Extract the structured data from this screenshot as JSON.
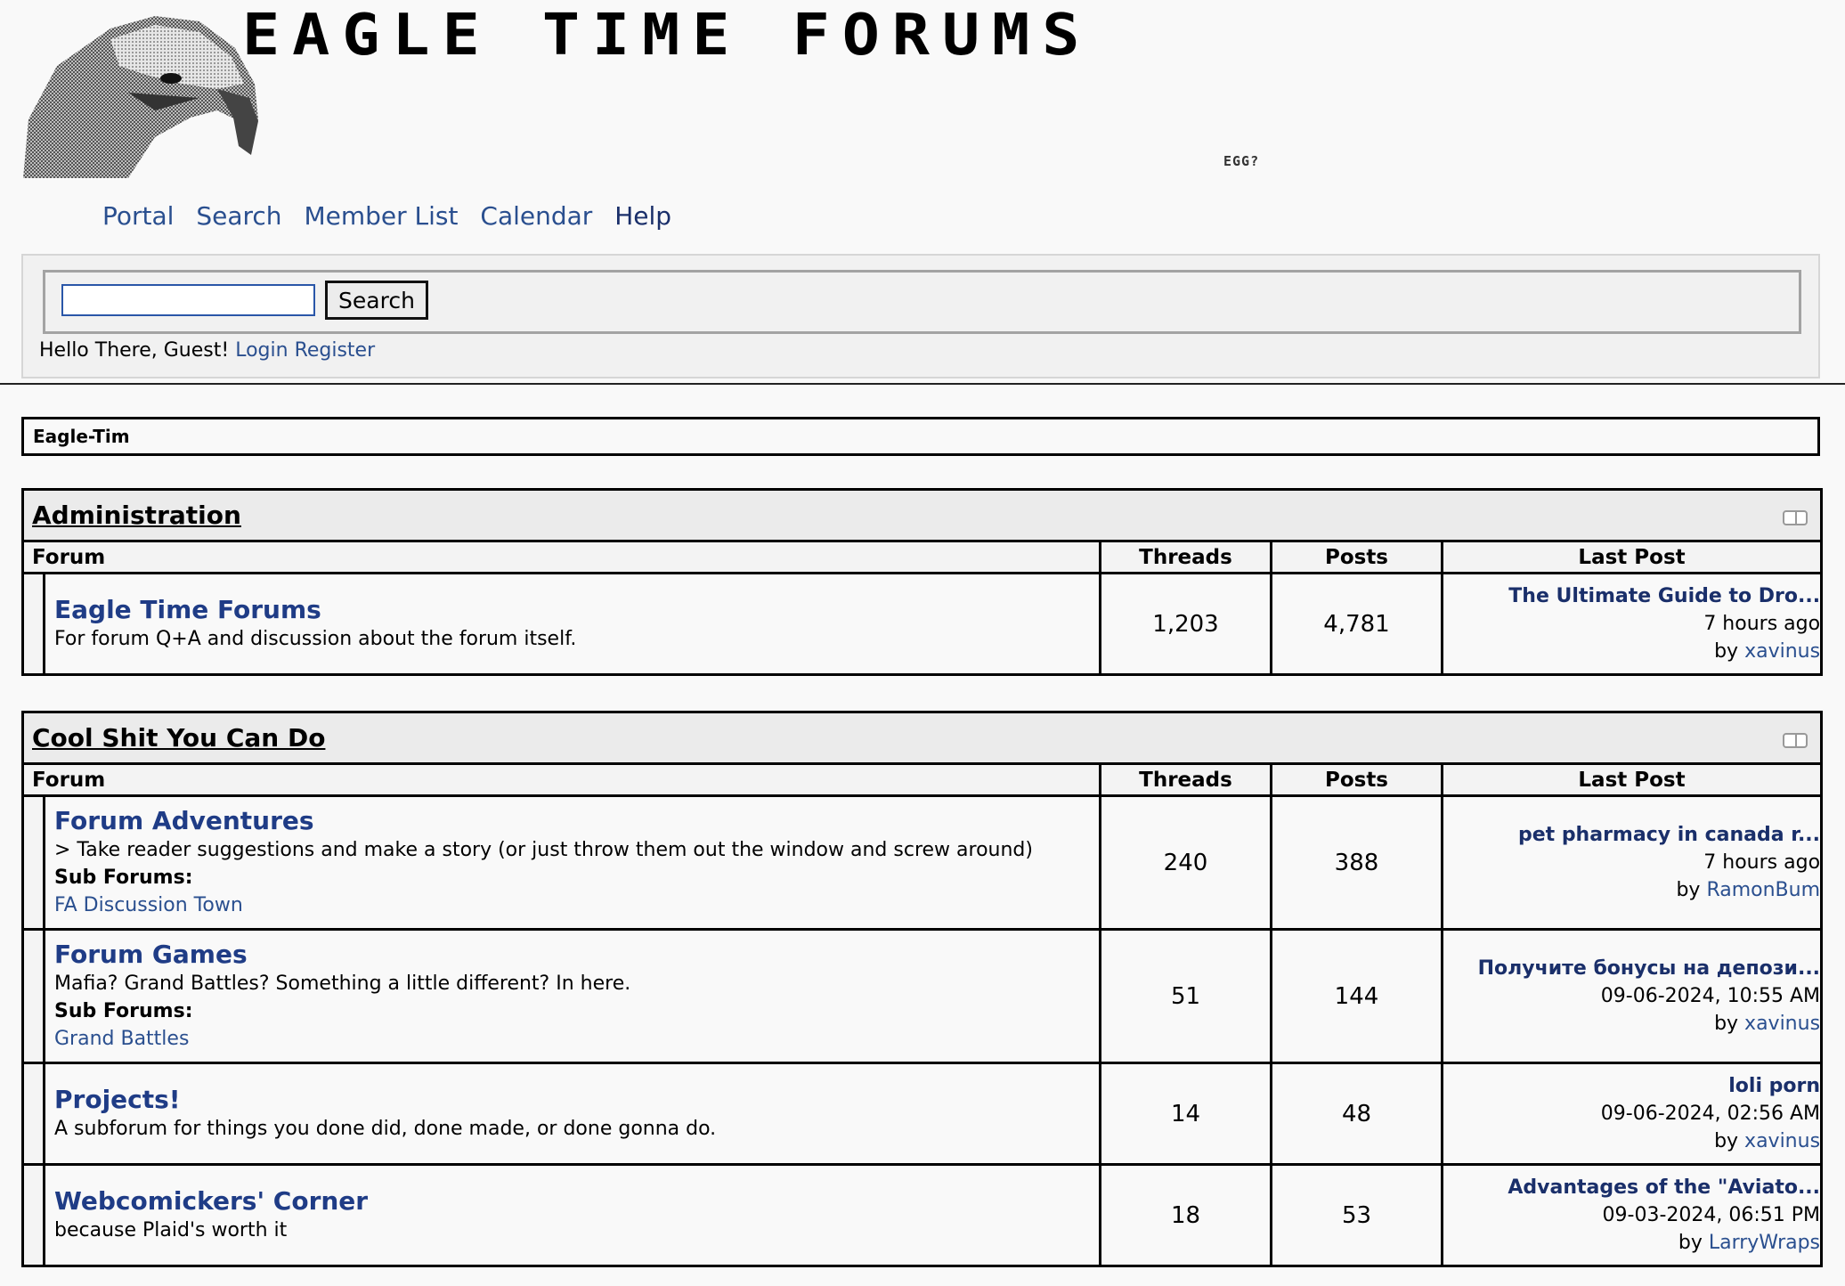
{
  "header": {
    "site_title": "EAGLE TIME FORUMS",
    "egg_text": "EGG?",
    "nav": [
      "Portal",
      "Search",
      "Member List",
      "Calendar",
      "Help"
    ]
  },
  "search": {
    "placeholder": "",
    "button_label": "Search"
  },
  "greeting": {
    "text": "Hello There, Guest!",
    "login": "Login",
    "register": "Register"
  },
  "breadcrumb": "Eagle-Tim",
  "columns": {
    "forum": "Forum",
    "threads": "Threads",
    "posts": "Posts",
    "last_post": "Last Post"
  },
  "categories": [
    {
      "title": "Administration",
      "forums": [
        {
          "name": "Eagle Time Forums",
          "description": "For forum Q+A and discussion about the forum itself.",
          "threads": "1,203",
          "posts": "4,781",
          "last_post_title": "The Ultimate Guide to Dro...",
          "last_post_time": "7 hours ago",
          "last_post_by_label": "by",
          "last_post_by": "xavinus"
        }
      ]
    },
    {
      "title": "Cool Shit You Can Do",
      "forums": [
        {
          "name": "Forum Adventures",
          "description": "> Take reader suggestions and make a story (or just throw them out the window and screw around)",
          "subforums_label": "Sub Forums:",
          "subforum": "FA Discussion Town",
          "threads": "240",
          "posts": "388",
          "last_post_title": "pet pharmacy in canada r...",
          "last_post_time": "7 hours ago",
          "last_post_by_label": "by",
          "last_post_by": "RamonBum"
        },
        {
          "name": "Forum Games",
          "description": "Mafia? Grand Battles? Something a little different? In here.",
          "subforums_label": "Sub Forums:",
          "subforum": "Grand Battles",
          "threads": "51",
          "posts": "144",
          "last_post_title": "Получите бонусы на депози...",
          "last_post_time": "09-06-2024, 10:55 AM",
          "last_post_by_label": "by",
          "last_post_by": "xavinus"
        },
        {
          "name": "Projects!",
          "description": "A subforum for things you done did, done made, or done gonna do.",
          "threads": "14",
          "posts": "48",
          "last_post_title": "loli porn",
          "last_post_time": "09-06-2024, 02:56 AM",
          "last_post_by_label": "by",
          "last_post_by": "xavinus"
        },
        {
          "name": "Webcomickers' Corner",
          "description": "because Plaid's worth it",
          "threads": "18",
          "posts": "53",
          "last_post_title": "Advantages of the \"Aviato...",
          "last_post_time": "09-03-2024, 06:51 PM",
          "last_post_by_label": "by",
          "last_post_by": "LarryWraps"
        }
      ]
    }
  ]
}
